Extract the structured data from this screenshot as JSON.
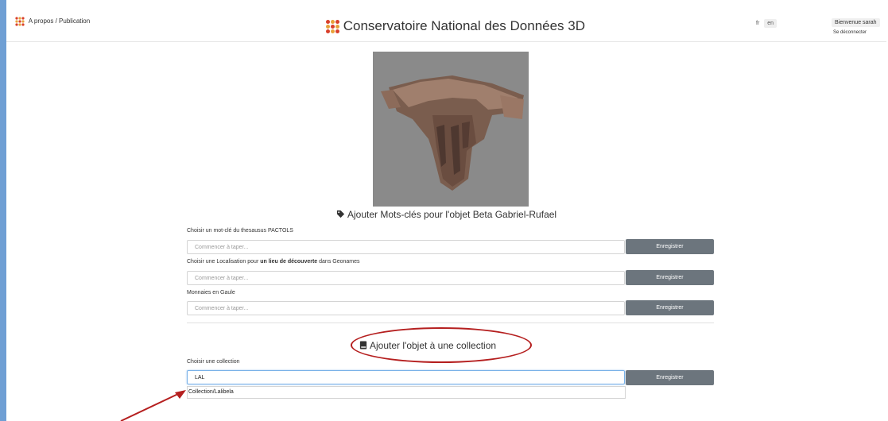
{
  "header": {
    "nav_link": "A propos / Publication",
    "title": "Conservatoire National des Données 3D",
    "lang_fr": "fr",
    "lang_en": "en",
    "welcome": "Bienvenue sarah",
    "logout": "Se déconnecter"
  },
  "keywords": {
    "heading": "Ajouter Mots-clés pour l'objet Beta Gabriel-Rufael",
    "pactols_label": "Choisir un mot-clé du thesausus PACTOLS",
    "pactols_placeholder": "Commencer à taper...",
    "geo_label_pre": "Choisir une Localisation pour ",
    "geo_label_bold": "un lieu de découverte",
    "geo_label_post": " dans Geonames",
    "geo_placeholder": "Commencer à taper...",
    "monnaies_label": "Monnaies en Gaule",
    "monnaies_placeholder": "Commencer à taper...",
    "save_label": "Enregistrer"
  },
  "collection": {
    "heading": "Ajouter l'objet à une collection",
    "label": "Choisir une collection",
    "value": "LAL",
    "save_label": "Enregistrer",
    "suggestion": "Collection/Lalibela"
  },
  "colors": {
    "accent_frame": "#6f9fd4",
    "button": "#6c757d",
    "annotation": "#b51f1f"
  }
}
